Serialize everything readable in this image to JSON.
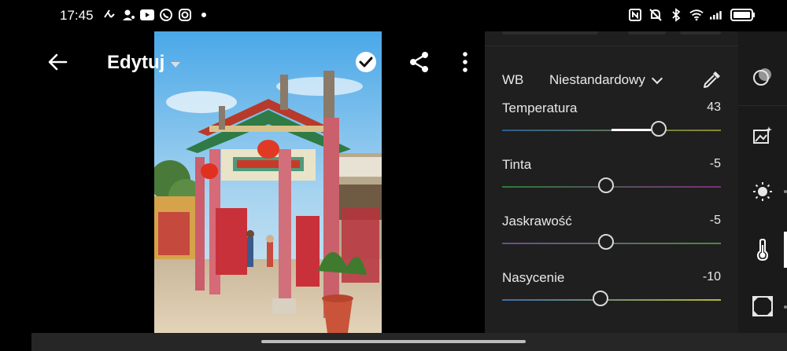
{
  "status_bar": {
    "time": "17:45",
    "left_icons": [
      "calls-icon",
      "contact-icon",
      "youtube-icon",
      "whatsapp-icon",
      "instagram-icon",
      "dot-icon"
    ],
    "right_icons": [
      "nfc-icon",
      "mute-icon",
      "bluetooth-icon",
      "wifi-icon",
      "signal-icon",
      "battery-icon"
    ]
  },
  "toolbar": {
    "back_icon": "back-arrow-icon",
    "title": "Edytuj",
    "confirm_icon": "check-circle-icon",
    "share_icon": "share-icon",
    "more_icon": "more-vert-icon"
  },
  "white_balance": {
    "label": "WB",
    "mode": "Niestandardowy",
    "eyedropper_icon": "eyedropper-icon"
  },
  "sliders": [
    {
      "label": "Temperatura",
      "value": "43",
      "position": 0.715,
      "colors": [
        "#2c5e8e",
        "#8a8a2a"
      ]
    },
    {
      "label": "Tinta",
      "value": "-5",
      "position": 0.475,
      "colors": [
        "#2e7a3a",
        "#7a2e7a"
      ]
    },
    {
      "label": "Jaskrawość",
      "value": "-5",
      "position": 0.475,
      "colors": [
        "#6a4c93",
        "#4c8a3a"
      ]
    },
    {
      "label": "Nasycenie",
      "value": "-10",
      "position": 0.45,
      "colors": [
        "#3a6ea5",
        "#b7b53a"
      ]
    }
  ],
  "rail": {
    "items": [
      "masking-icon",
      "auto-enhance-icon",
      "light-icon",
      "color-temp-icon",
      "vignette-icon"
    ],
    "active": "color-temp-icon"
  },
  "colors": {
    "panel_bg": "#1f1f1f",
    "rail_bg": "#1a1a1a",
    "accent": "#ffffff"
  }
}
